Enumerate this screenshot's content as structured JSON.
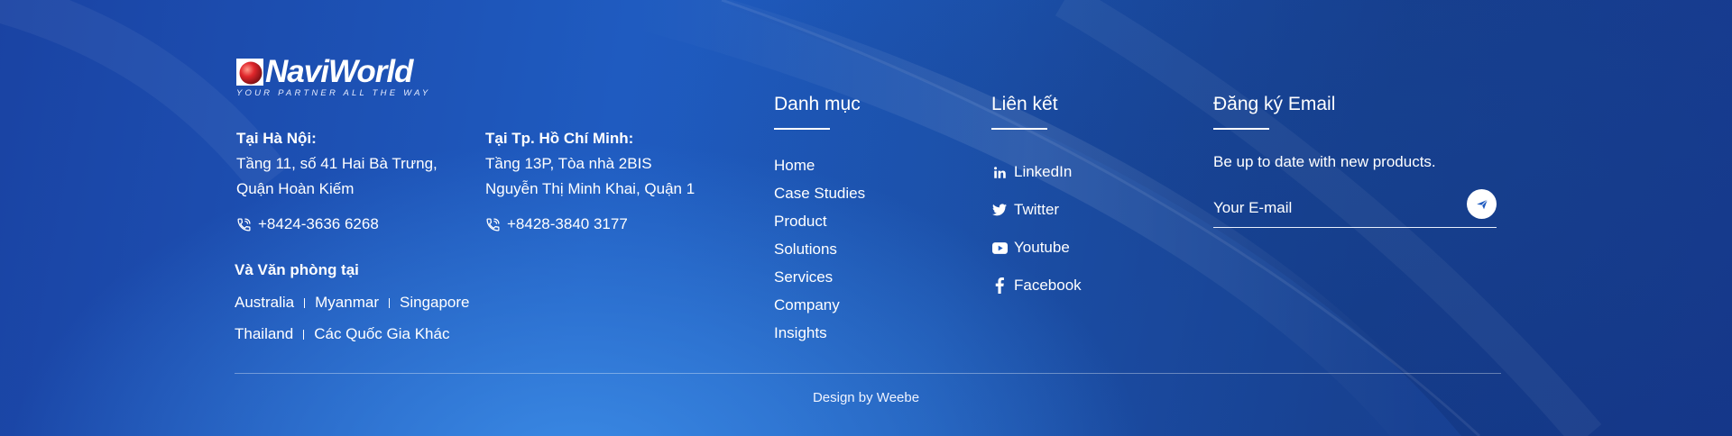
{
  "brand": {
    "name": "NaviWorld",
    "tagline": "YOUR PARTNER ALL THE WAY"
  },
  "hanoi": {
    "title": "Tại Hà Nội:",
    "line1": "Tầng 11, số 41 Hai Bà Trưng,",
    "line2": "Quận Hoàn Kiếm",
    "phone": "+8424-3636 6268"
  },
  "hcm": {
    "title": "Tại Tp. Hồ Chí Minh:",
    "line1": "Tầng 13P, Tòa nhà 2BIS",
    "line2": "Nguyễn Thị Minh Khai, Quận 1",
    "phone": "+8428-3840 3177"
  },
  "offices": {
    "title": "Và Văn phòng tại",
    "row1": [
      "Australia",
      "Myanmar",
      "Singapore"
    ],
    "row2": [
      "Thailand",
      "Các Quốc Gia Khác"
    ]
  },
  "categories": {
    "title": "Danh mục",
    "items": [
      "Home",
      "Case Studies",
      "Product",
      "Solutions",
      "Services",
      "Company",
      "Insights"
    ]
  },
  "links": {
    "title": "Liên kết",
    "items": [
      {
        "label": "LinkedIn",
        "icon": "linkedin-icon"
      },
      {
        "label": "Twitter",
        "icon": "twitter-icon"
      },
      {
        "label": "Youtube",
        "icon": "youtube-icon"
      },
      {
        "label": "Facebook",
        "icon": "facebook-icon"
      }
    ]
  },
  "newsletter": {
    "title": "Đăng ký Email",
    "text": "Be up to date with new products.",
    "placeholder": "Your E-mail",
    "send_icon": "send-icon"
  },
  "footer": {
    "credit": "Design by Weebe"
  },
  "colors": {
    "background": "#1f5bc0",
    "text": "#ffffff",
    "logo_ball": "#d8262a"
  }
}
